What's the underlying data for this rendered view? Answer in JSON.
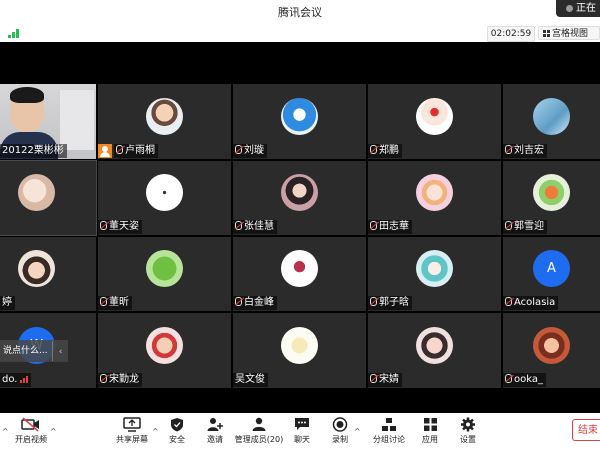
{
  "window": {
    "title": "腾讯会议"
  },
  "speaking": {
    "label": "正在"
  },
  "infobar": {
    "timer": "02:02:59",
    "view_label": "宫格视图"
  },
  "tiles": [
    {
      "name": "20122栗彬彬",
      "kind": "video"
    },
    {
      "name": "卢雨桐",
      "kind": "avatar",
      "host": true
    },
    {
      "name": "刘璇",
      "kind": "avatar"
    },
    {
      "name": "郑鹏",
      "kind": "avatar"
    },
    {
      "name": "刘吉宏",
      "kind": "avatar"
    },
    {
      "name": "",
      "kind": "avatar"
    },
    {
      "name": "董天姿",
      "kind": "avatar"
    },
    {
      "name": "张佳慧",
      "kind": "avatar"
    },
    {
      "name": "田志華",
      "kind": "avatar"
    },
    {
      "name": "郭雪迎",
      "kind": "avatar"
    },
    {
      "name": "婷",
      "kind": "avatar"
    },
    {
      "name": "董昕",
      "kind": "avatar"
    },
    {
      "name": "白金峰",
      "kind": "avatar"
    },
    {
      "name": "郭子晗",
      "kind": "avatar"
    },
    {
      "name": "Acolasia",
      "kind": "letter",
      "letter": "A"
    },
    {
      "name": "do.",
      "kind": "letter",
      "letter": "W"
    },
    {
      "name": "宋勤龙",
      "kind": "avatar"
    },
    {
      "name": "吴文俊",
      "kind": "avatar"
    },
    {
      "name": "宋婧",
      "kind": "avatar"
    },
    {
      "name": "ooka_",
      "kind": "avatar"
    }
  ],
  "chat_popup": {
    "text": "说点什么...",
    "chevron": "‹"
  },
  "toolbar": {
    "items": [
      {
        "label": "开启视频",
        "icon": "video-off-icon"
      },
      {
        "label": "共享屏幕",
        "icon": "share-screen-icon"
      },
      {
        "label": "安全",
        "icon": "shield-icon"
      },
      {
        "label": "邀请",
        "icon": "invite-icon"
      },
      {
        "label": "管理成员(20)",
        "icon": "members-icon"
      },
      {
        "label": "聊天",
        "icon": "chat-icon"
      },
      {
        "label": "录制",
        "icon": "record-icon"
      },
      {
        "label": "分组讨论",
        "icon": "breakout-icon"
      },
      {
        "label": "应用",
        "icon": "apps-icon"
      },
      {
        "label": "设置",
        "icon": "gear-icon"
      }
    ],
    "end_label": "结束"
  },
  "colors": {
    "tile_bg": "#2b2b2b",
    "accent_blue": "#1e6df0",
    "end_red": "#e04040",
    "signal_green": "#2cba55",
    "host_orange": "#f08a24"
  }
}
